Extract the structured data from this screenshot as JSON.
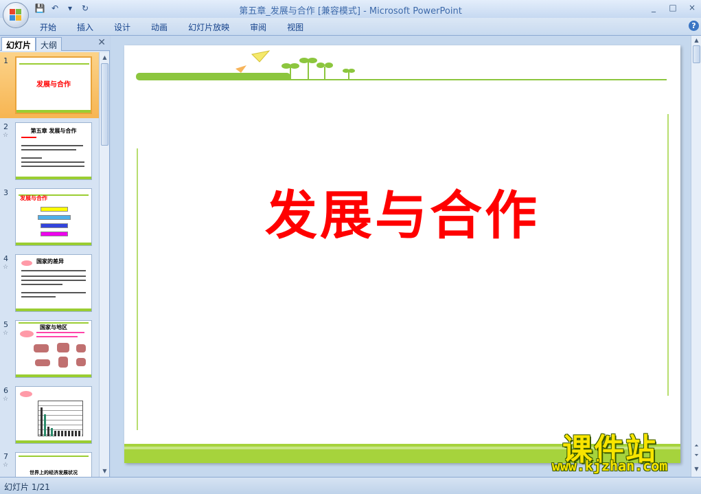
{
  "window": {
    "title": "第五章_发展与合作 [兼容模式] - Microsoft PowerPoint",
    "controls": [
      "_",
      "□",
      "×"
    ]
  },
  "qat": {
    "save": "💾",
    "undo": "↶",
    "redo": "↻",
    "more": "▾"
  },
  "ribbon": {
    "tabs": [
      "开始",
      "插入",
      "设计",
      "动画",
      "幻灯片放映",
      "审阅",
      "视图"
    ],
    "help": "?"
  },
  "left_pane": {
    "tab_slides": "幻灯片",
    "tab_outline": "大纲",
    "close": "✕",
    "thumbnails": [
      {
        "num": "1",
        "anim": "",
        "title": "发展与合作",
        "selected": true
      },
      {
        "num": "2",
        "anim": "☆",
        "title": "第五章 发展与合作",
        "selected": false
      },
      {
        "num": "3",
        "anim": "",
        "title": "发展与合作",
        "selected": false
      },
      {
        "num": "4",
        "anim": "☆",
        "title": "国家的差异",
        "selected": false
      },
      {
        "num": "5",
        "anim": "☆",
        "title": "国家与地区",
        "selected": false
      },
      {
        "num": "6",
        "anim": "☆",
        "title": "",
        "selected": false
      },
      {
        "num": "7",
        "anim": "☆",
        "title": "世界上的经济发展状况",
        "selected": false
      }
    ]
  },
  "slide": {
    "title": "发展与合作",
    "accent_green": "#9acd32",
    "title_color": "#ff0000"
  },
  "status": {
    "slide_counter": "幻灯片 1/21"
  },
  "watermark": {
    "brand": "课件站",
    "url": "www.kjzhan.com"
  }
}
